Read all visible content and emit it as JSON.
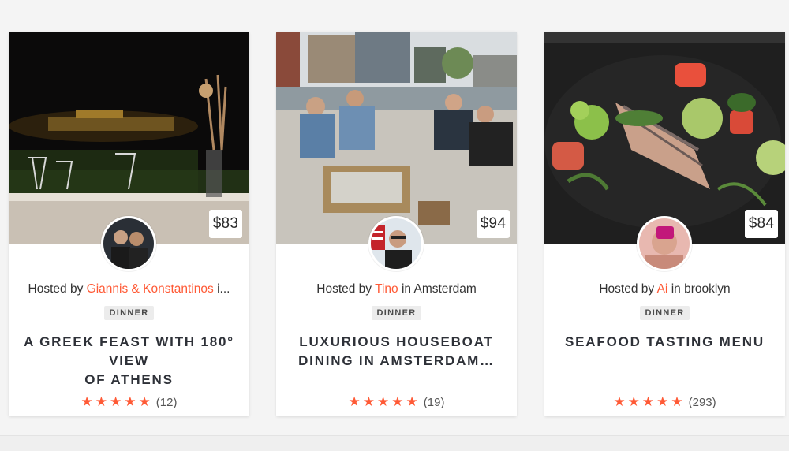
{
  "cards": [
    {
      "price": "$83",
      "host_prefix": "Hosted by ",
      "host_name": "Giannis & Konstantinos",
      "host_suffix": " i...",
      "category": "DINNER",
      "title_line1": "A GREEK FEAST WITH 180° VIEW",
      "title_line2": "OF ATHENS",
      "rating": 5,
      "review_count": "(12)"
    },
    {
      "price": "$94",
      "host_prefix": "Hosted by ",
      "host_name": "Tino",
      "host_suffix": " in Amsterdam",
      "category": "DINNER",
      "title_line1": "LUXURIOUS HOUSEBOAT",
      "title_line2": "DINING IN AMSTERDAM…",
      "rating": 5,
      "review_count": "(19)"
    },
    {
      "price": "$84",
      "host_prefix": "Hosted by ",
      "host_name": "Ai",
      "host_suffix": " in brooklyn",
      "category": "DINNER",
      "title_line1": "SEAFOOD TASTING MENU",
      "title_line2": "",
      "rating": 5,
      "review_count": "(293)"
    }
  ],
  "colors": {
    "accent": "#ff5a36",
    "badge_bg": "#ececec",
    "title_text": "#2e3138"
  },
  "icons": {
    "star": "star-icon"
  }
}
